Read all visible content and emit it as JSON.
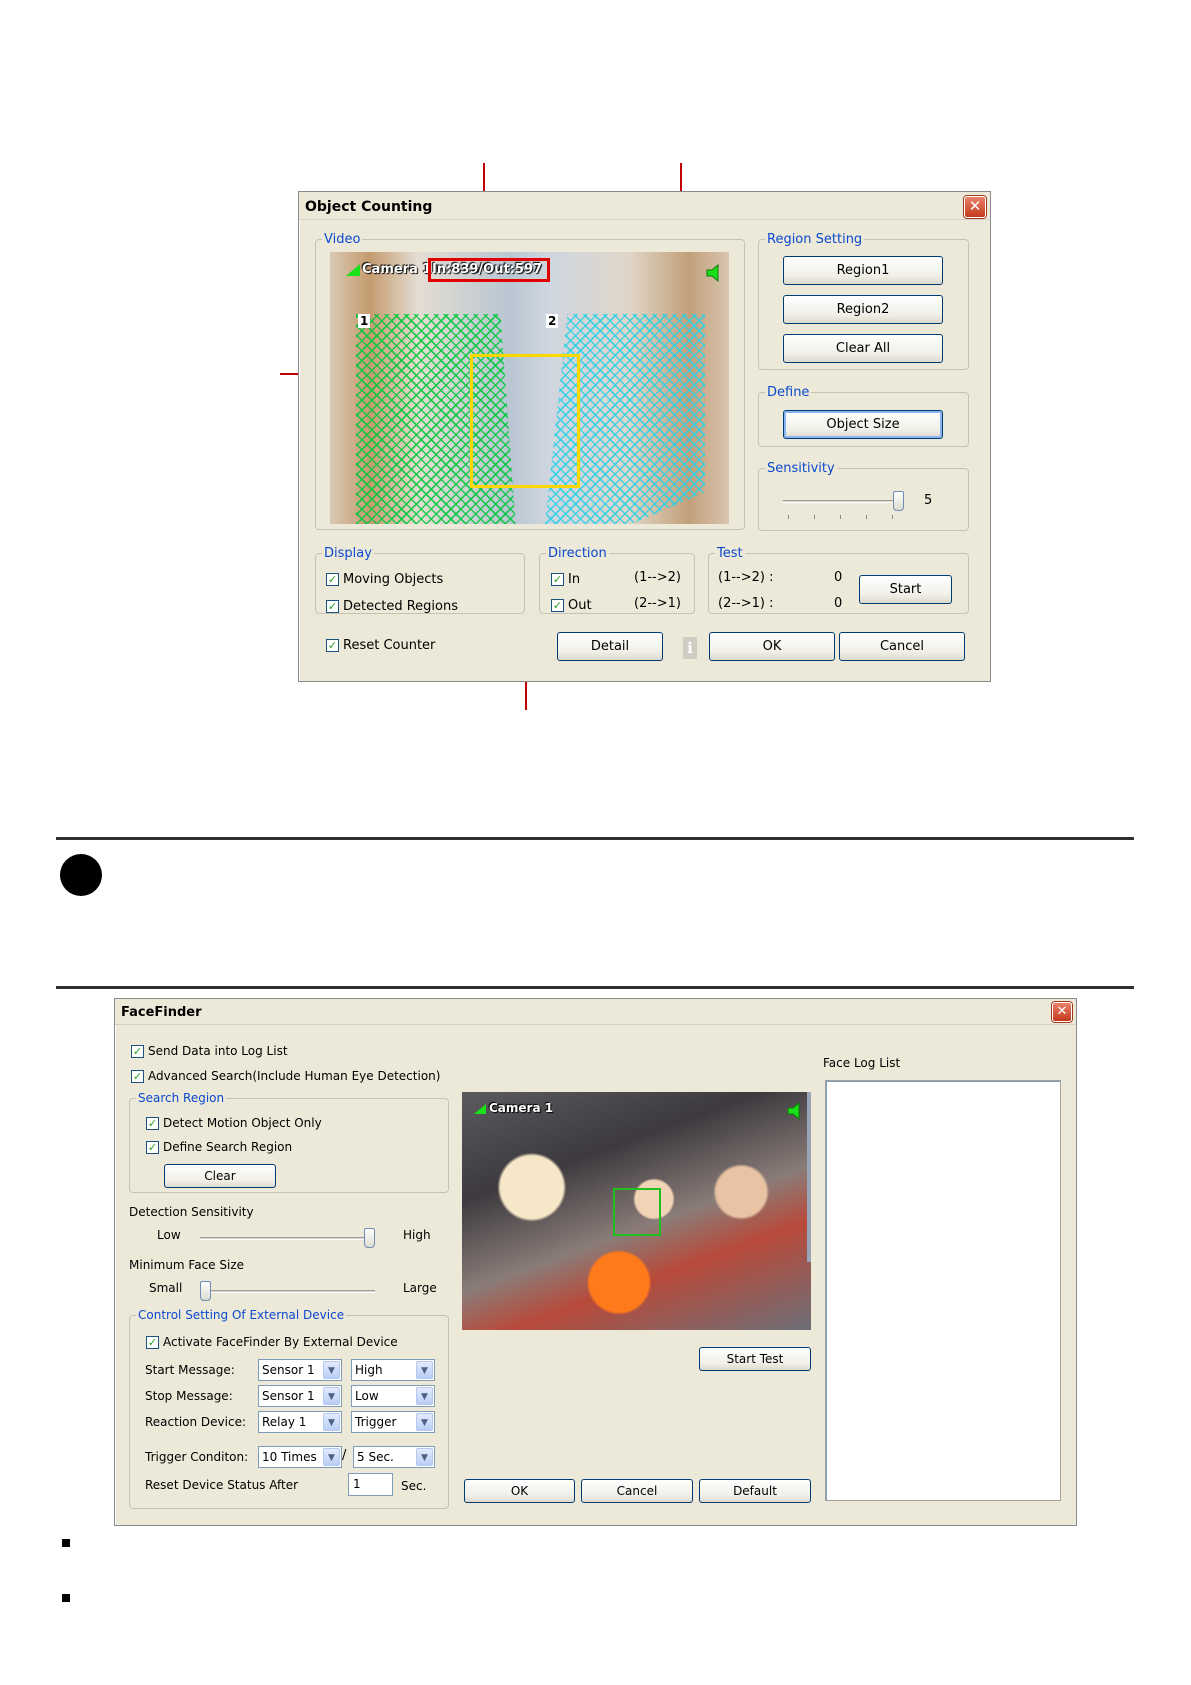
{
  "object_counting": {
    "title": "Object Counting",
    "video_group": "Video",
    "camera_label": "Camera 1",
    "counter_text": "In:839/Out:597",
    "region_marker_1": "1",
    "region_marker_2": "2",
    "region_setting": {
      "legend": "Region Setting",
      "region1": "Region1",
      "region2": "Region2",
      "clear_all": "Clear All"
    },
    "define": {
      "legend": "Define",
      "object_size": "Object Size"
    },
    "sensitivity": {
      "legend": "Sensitivity",
      "value": "5",
      "level": 5,
      "max": 5
    },
    "display": {
      "legend": "Display",
      "moving_objects": "Moving Objects",
      "detected_regions": "Detected Regions"
    },
    "direction": {
      "legend": "Direction",
      "in": "In",
      "in_arrow": "(1-->2)",
      "out": "Out",
      "out_arrow": "(2-->1)"
    },
    "test": {
      "legend": "Test",
      "row1_label": "(1-->2) :",
      "row1_value": "0",
      "row2_label": "(2-->1) :",
      "row2_value": "0",
      "start": "Start"
    },
    "reset_counter": "Reset Counter",
    "detail": "Detail",
    "ok": "OK",
    "cancel": "Cancel"
  },
  "facefinder": {
    "title": "FaceFinder",
    "send_data": "Send Data into Log List",
    "advanced_search": "Advanced Search(Include Human Eye Detection)",
    "search_region": {
      "legend": "Search Region",
      "detect_motion": "Detect Motion Object Only",
      "define_region": "Define Search Region",
      "clear": "Clear"
    },
    "detection_sensitivity": {
      "label": "Detection Sensitivity",
      "low": "Low",
      "high": "High",
      "level": 1.0
    },
    "min_face_size": {
      "label": "Minimum Face Size",
      "small": "Small",
      "large": "Large",
      "level": 0.0
    },
    "external": {
      "legend": "Control Setting Of External Device",
      "activate": "Activate FaceFinder By External Device",
      "start_label": "Start Message:",
      "start_sensor": "Sensor 1",
      "start_level": "High",
      "stop_label": "Stop Message:",
      "stop_sensor": "Sensor 1",
      "stop_level": "Low",
      "reaction_label": "Reaction Device:",
      "reaction_device": "Relay 1",
      "reaction_mode": "Trigger",
      "trigger_label": "Trigger Conditon:",
      "trigger_times": "10 Times",
      "trigger_sep": "/",
      "trigger_secs": "5 Sec.",
      "reset_label": "Reset Device Status After",
      "reset_value": "1",
      "reset_unit": "Sec."
    },
    "camera_label": "Camera 1",
    "start_test": "Start Test",
    "ok": "OK",
    "cancel": "Cancel",
    "default": "Default",
    "face_log_list": "Face Log List"
  },
  "colors": {
    "legend_blue": "#0b49d0",
    "annotation_red": "#c00000",
    "region_green": "#00c83c",
    "region_cyan": "#28d2e6",
    "object_box_yellow": "#ffd800",
    "face_box_green": "#20c020"
  }
}
